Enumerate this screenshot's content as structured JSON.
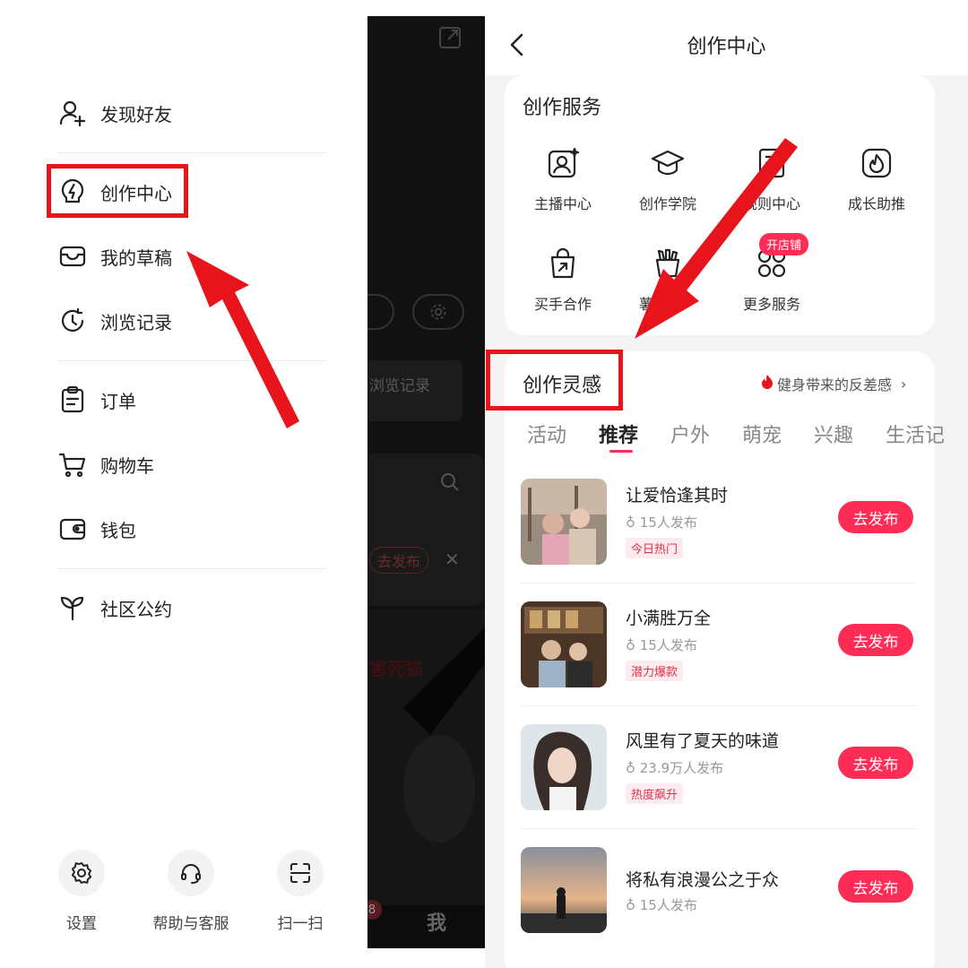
{
  "drawer": {
    "menu": [
      {
        "label": "发现好友",
        "icon": "add-user-icon"
      },
      {
        "label": "创作中心",
        "icon": "lightning-bulb-icon"
      },
      {
        "label": "我的草稿",
        "icon": "inbox-tray-icon"
      },
      {
        "label": "浏览记录",
        "icon": "history-clock-icon"
      },
      {
        "label": "订单",
        "icon": "clipboard-icon"
      },
      {
        "label": "购物车",
        "icon": "cart-icon"
      },
      {
        "label": "钱包",
        "icon": "wallet-icon"
      },
      {
        "label": "社区公约",
        "icon": "sprout-icon"
      }
    ],
    "bottom": [
      {
        "label": "设置",
        "icon": "gear-icon"
      },
      {
        "label": "帮助与客服",
        "icon": "headset-icon"
      },
      {
        "label": "扫一扫",
        "icon": "scan-icon"
      }
    ]
  },
  "background": {
    "browse_history": "浏览记录",
    "publish_button": "去发布",
    "tab_me": "我",
    "notification_count": "8"
  },
  "panel": {
    "title": "创作中心",
    "services_heading": "创作服务",
    "services": [
      {
        "label": "主播中心",
        "icon": "streamer-icon"
      },
      {
        "label": "创作学院",
        "icon": "graduation-cap-icon"
      },
      {
        "label": "规则中心",
        "icon": "rulebook-icon"
      },
      {
        "label": "成长助推",
        "icon": "flame-icon"
      },
      {
        "label": "买手合作",
        "icon": "shopping-bag-icon"
      },
      {
        "label": "薯条推广",
        "icon": "fries-icon"
      },
      {
        "label": "更多服务",
        "icon": "grid-dots-icon"
      }
    ],
    "more_badge": "开店铺",
    "inspiration_heading": "创作灵感",
    "inspiration_link": "健身带来的反差感",
    "tabs": [
      "活动",
      "推荐",
      "户外",
      "萌宠",
      "兴趣",
      "生活记"
    ],
    "active_tab": "推荐",
    "items": [
      {
        "title": "让爱恰逢其时",
        "count": "15人发布",
        "tag": "今日热门",
        "button": "去发布"
      },
      {
        "title": "小满胜万全",
        "count": "15人发布",
        "tag": "潜力爆款",
        "button": "去发布"
      },
      {
        "title": "风里有了夏天的味道",
        "count": "23.9万人发布",
        "tag": "热度飙升",
        "button": "去发布"
      },
      {
        "title": "将私有浪漫公之于众",
        "count": "15人发布",
        "tag": "",
        "button": "去发布"
      }
    ]
  },
  "colors": {
    "accent_red": "#ff2d55",
    "annotation_red": "#e8141c"
  }
}
